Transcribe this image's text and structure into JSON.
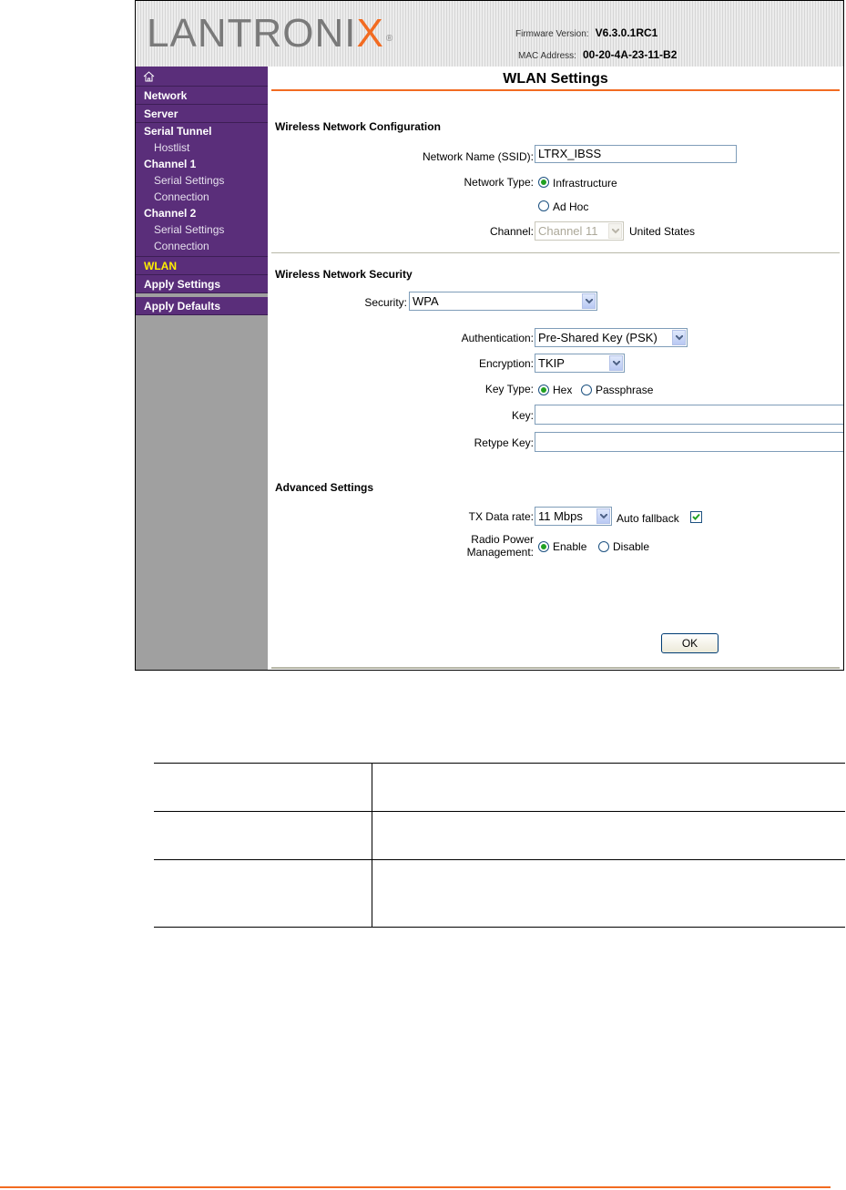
{
  "header": {
    "logo_text": "LANTRONIX",
    "firmware_label": "Firmware Version:",
    "firmware_value": "V6.3.0.1RC1",
    "mac_label": "MAC Address:",
    "mac_value": "00-20-4A-23-11-B2"
  },
  "sidebar": {
    "home_icon": "home-icon",
    "items": {
      "network": "Network",
      "server": "Server",
      "serial_tunnel": "Serial Tunnel",
      "hostlist": "Hostlist",
      "channel1": "Channel 1",
      "ch1_serial": "Serial Settings",
      "ch1_connection": "Connection",
      "channel2": "Channel 2",
      "ch2_serial": "Serial Settings",
      "ch2_connection": "Connection",
      "wlan": "WLAN",
      "apply_settings": "Apply Settings",
      "apply_defaults": "Apply Defaults"
    }
  },
  "main": {
    "title": "WLAN Settings",
    "config": {
      "heading": "Wireless Network Configuration",
      "ssid_label": "Network Name (SSID):",
      "ssid_value": "LTRX_IBSS",
      "network_type_label": "Network Type:",
      "infrastructure": "Infrastructure",
      "adhoc": "Ad Hoc",
      "channel_label": "Channel:",
      "channel_value": "Channel 11",
      "region": "United States"
    },
    "security": {
      "heading": "Wireless Network Security",
      "security_label": "Security:",
      "security_value": "WPA",
      "auth_label": "Authentication:",
      "auth_value": "Pre-Shared Key (PSK)",
      "enc_label": "Encryption:",
      "enc_value": "TKIP",
      "keytype_label": "Key Type:",
      "hex": "Hex",
      "passphrase": "Passphrase",
      "key_label": "Key:",
      "key_value": "",
      "retype_label": "Retype Key:",
      "retype_value": ""
    },
    "advanced": {
      "heading": "Advanced Settings",
      "tx_label": "TX Data rate:",
      "tx_value": "11 Mbps",
      "fallback_label": "Auto fallback",
      "fallback_checked": true,
      "radio_power_label_1": "Radio Power",
      "radio_power_label_2": "Management:",
      "enable": "Enable",
      "disable": "Disable"
    },
    "ok_button": "OK"
  },
  "colors": {
    "nav_purple": "#5a2e7a",
    "active_nav": "#ffef00",
    "accent_orange": "#f26b21",
    "sidebar_gray": "#a0a0a0"
  }
}
